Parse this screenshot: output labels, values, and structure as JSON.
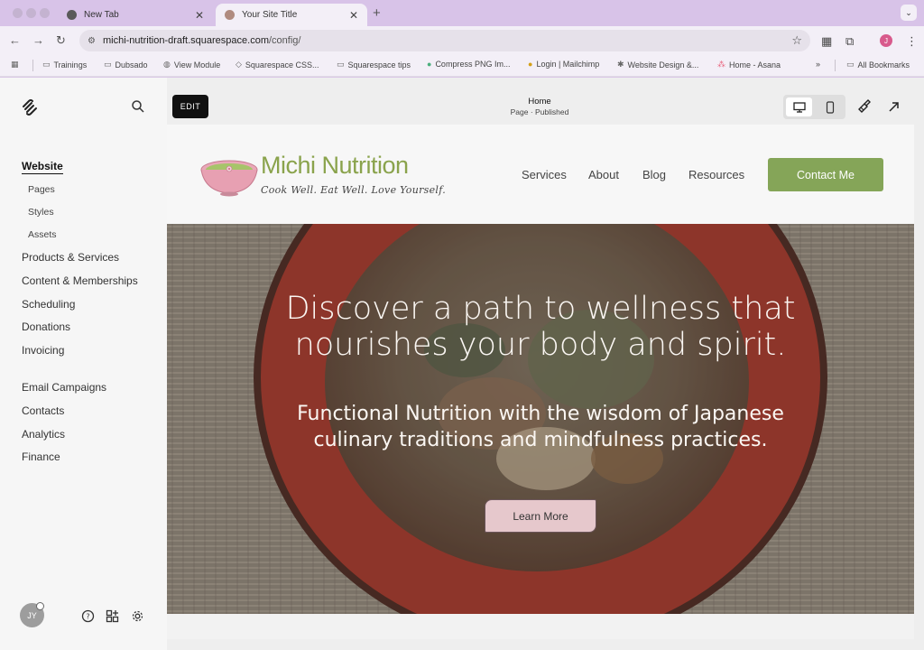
{
  "browser": {
    "tabs": [
      {
        "title": "New Tab",
        "active": false
      },
      {
        "title": "Your Site Title",
        "active": true
      }
    ],
    "url_host": "michi-nutrition-draft.squarespace.com",
    "url_path": "/config/",
    "bookmarks": [
      "Trainings",
      "Dubsado",
      "View Module",
      "Squarespace CSS...",
      "Squarespace tips",
      "Compress PNG Im...",
      "Login | Mailchimp",
      "Website Design &...",
      "Home - Asana"
    ],
    "all_bookmarks": "All Bookmarks",
    "profile_initial": "J"
  },
  "sidebar": {
    "website": "Website",
    "sub_items": [
      "Pages",
      "Styles",
      "Assets"
    ],
    "items": [
      "Products & Services",
      "Content & Memberships",
      "Scheduling",
      "Donations",
      "Invoicing"
    ],
    "items2": [
      "Email Campaigns",
      "Contacts",
      "Analytics",
      "Finance"
    ],
    "avatar_initials": "JY"
  },
  "editor": {
    "edit_label": "EDIT",
    "page_title": "Home",
    "page_status": "Page · Published"
  },
  "site": {
    "brand": "Michi Nutrition",
    "tagline": "Cook Well. Eat Well. Love Yourself.",
    "nav": [
      "Services",
      "About",
      "Blog",
      "Resources"
    ],
    "contact_label": "Contact Me",
    "hero_heading": "Discover a path to wellness that nourishes your body and spirit.",
    "hero_sub": "Functional Nutrition with the wisdom of Japanese culinary traditions and mindfulness practices.",
    "learn_more": "Learn More"
  },
  "colors": {
    "tab_strip": "#d8c3e8",
    "brand_green": "#8aa34c",
    "contact_button": "#85a558",
    "learn_button": "#e6c8cc",
    "bowl_red": "#a5392c"
  }
}
